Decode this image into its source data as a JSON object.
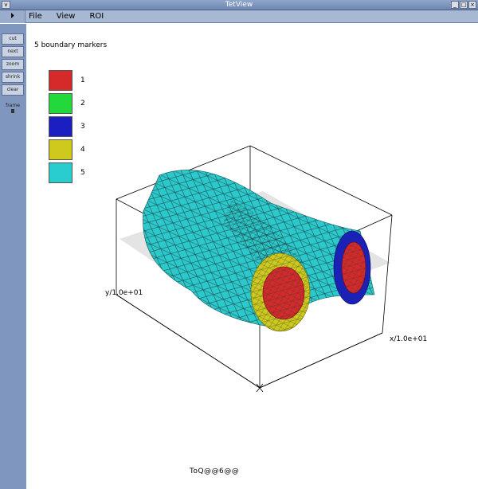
{
  "window": {
    "title": "TetView",
    "sys_icon": "v",
    "min_icon": "_",
    "max_icon": "□",
    "close_icon": "×"
  },
  "menubar": {
    "play_icon": "⏵",
    "menus": [
      "File",
      "View",
      "ROI"
    ]
  },
  "toolbar": {
    "buttons": [
      "cut",
      "next",
      "zoom",
      "shrink",
      "clear"
    ],
    "slider_label": "frame"
  },
  "viewport": {
    "caption": "5 boundary markers",
    "markers": [
      {
        "label": "1",
        "color": "#d52a2a"
      },
      {
        "label": "2",
        "color": "#22d83a"
      },
      {
        "label": "3",
        "color": "#1b1fc1"
      },
      {
        "label": "4",
        "color": "#cfc81d"
      },
      {
        "label": "5",
        "color": "#29cdd0"
      }
    ],
    "axis_x": "x/1.0e+01",
    "axis_y": "y/1.0e+01",
    "footer": "ToQ@@6@@"
  }
}
